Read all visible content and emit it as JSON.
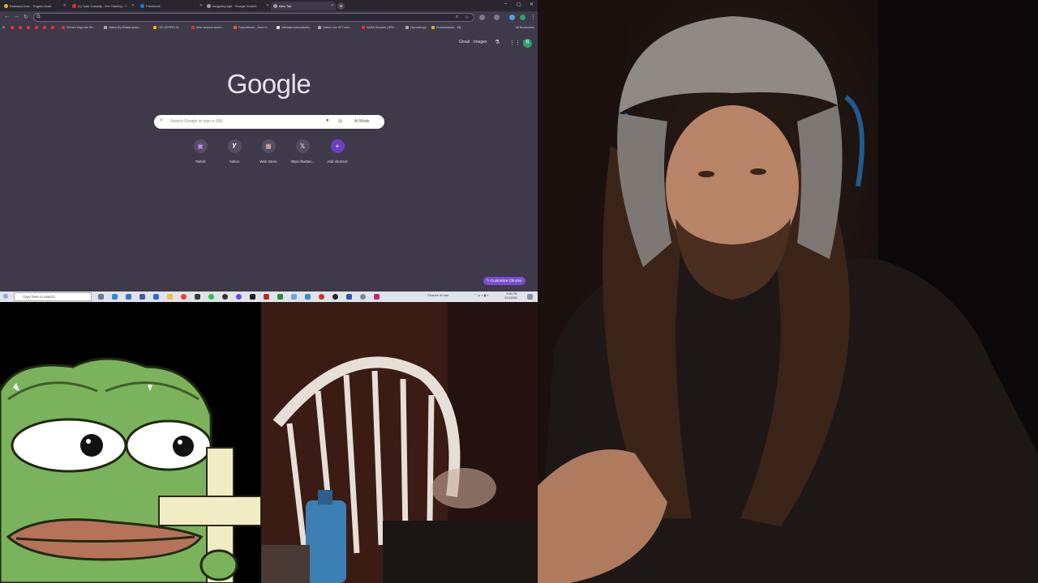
{
  "browser": {
    "tabs": [
      {
        "title": "Kickback.how - Trugam Avail",
        "color": "#e9b02a"
      },
      {
        "title": "(1) Tyler Cassidy - live Gaming - Y",
        "color": "#e33030"
      },
      {
        "title": "Facebook",
        "color": "#1877f2"
      },
      {
        "title": "longpong age - Google Search",
        "color": "#9aa0a6"
      },
      {
        "title": "New Tab",
        "color": "#9aa0a6"
      }
    ],
    "window_controls": {
      "minimize": "–",
      "maximize": "▢",
      "close": "✕"
    },
    "bookmarks": [
      {
        "label": "Stream Days the Re...",
        "color": "#e33030"
      },
      {
        "label": "Watch By Whack Autou...",
        "color": "#aaaaaa"
      },
      {
        "label": "LED ZEPPELIN -",
        "color": "#f5b400"
      },
      {
        "label": "Ante-famous downl...",
        "color": "#e33030"
      },
      {
        "label": "Francefleme - Save H...",
        "color": "#e25a20"
      },
      {
        "label": "Ultimateclubstudiodby",
        "color": "#dddddd"
      },
      {
        "label": "Watch Live HFT and...",
        "color": "#aaaaaa"
      },
      {
        "label": "NASA Streams | BRC...",
        "color": "#e33030"
      },
      {
        "label": "Opensimcpe",
        "color": "#aaaaaa"
      },
      {
        "label": "Kickbackstore - My...",
        "color": "#e9b02a"
      }
    ],
    "all_bookmarks": "All Bookmarks",
    "header_links": {
      "gmail": "Gmail",
      "images": "Images"
    },
    "profile_initial": "R",
    "google_logo": "Google",
    "search": {
      "placeholder": "Search Google or type a URL",
      "ai_mode": "AI Mode"
    },
    "shortcuts": [
      {
        "label": "Twitch",
        "glyph": "▣",
        "color": "#9146ff"
      },
      {
        "label": "Yahoo",
        "glyph": "Y",
        "color": "#ffffff"
      },
      {
        "label": "Web Store",
        "glyph": "▦",
        "color": "#dddddd"
      },
      {
        "label": "https://twitter...",
        "glyph": "X",
        "color": "#000000"
      },
      {
        "label": "Add shortcut",
        "glyph": "+",
        "color": "#7c4dd8"
      }
    ],
    "customize_label": "Customize Chrome"
  },
  "taskbar": {
    "search_placeholder": "Type here to search",
    "weather": "Chance of rain",
    "time": "9:36 PM",
    "date": "3/13/2025"
  },
  "colors": {
    "ntp_background": "#3f3a4a",
    "tabstrip": "#2a2630",
    "accent": "#7c4dd8",
    "pepe_green": "#7ab35b",
    "taskbar": "#dfe3ea"
  }
}
